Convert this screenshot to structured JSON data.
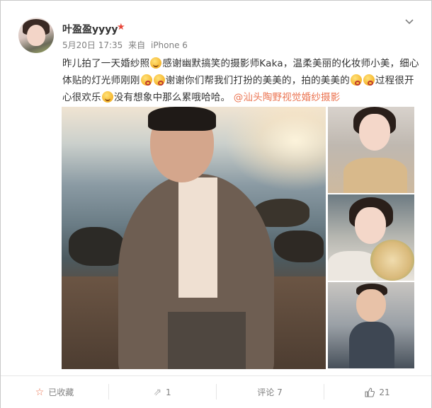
{
  "post": {
    "username": "叶盈盈yyyy",
    "date": "5月20日 17:35",
    "source_prefix": "来自",
    "source": "iPhone 6",
    "text_1": "昨儿拍了一天婚纱照",
    "text_2": "感谢幽默搞笑的摄影师Kaka，温柔美丽的化妆师小美，细心体贴的灯光师刚刚",
    "text_3": "谢谢你们帮我们打扮的美美的，拍的美美的",
    "text_4": "过程很开心很欢乐",
    "text_5": "没有想象中那么累哦哈哈。",
    "mention": "@汕头陶野视觉婚纱摄影"
  },
  "actions": {
    "favorite": "已收藏",
    "repost": "1",
    "comment": "评论 7",
    "like": "21"
  },
  "icons": {
    "vip": "vip-star-icon",
    "menu": "chevron-down-icon",
    "favorite": "star-icon",
    "repost": "repost-icon",
    "like": "thumbs-up-icon"
  },
  "colors": {
    "link": "#eb7350",
    "vip": "#e8473a",
    "muted": "#808080"
  }
}
